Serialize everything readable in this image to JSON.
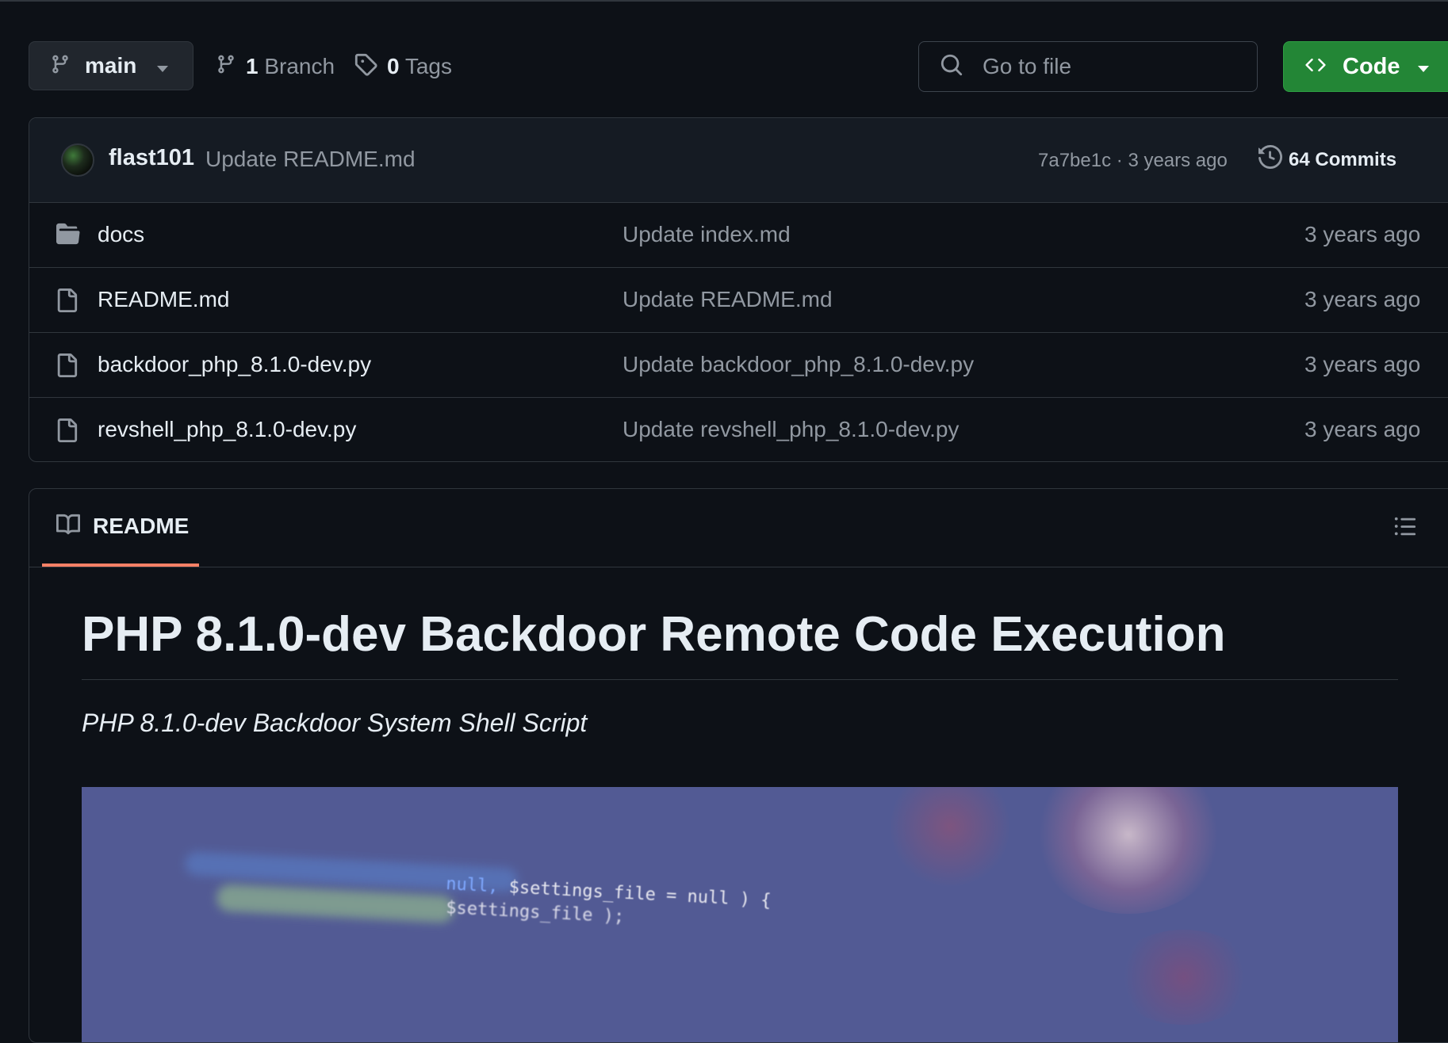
{
  "toolbar": {
    "branch_label": "main",
    "branch_count": "1",
    "branch_word": "Branch",
    "tag_count": "0",
    "tag_word": "Tags",
    "search_placeholder": "Go to file",
    "code_label": "Code"
  },
  "last_commit": {
    "author": "flast101",
    "message": "Update README.md",
    "sha": "7a7be1c",
    "separator": "·",
    "time": "3 years ago",
    "commits_count": "64 Commits"
  },
  "files": [
    {
      "name": "docs",
      "type": "folder",
      "message": "Update index.md",
      "time": "3 years ago"
    },
    {
      "name": "README.md",
      "type": "file",
      "message": "Update README.md",
      "time": "3 years ago"
    },
    {
      "name": "backdoor_php_8.1.0-dev.py",
      "type": "file",
      "message": "Update backdoor_php_8.1.0-dev.py",
      "time": "3 years ago"
    },
    {
      "name": "revshell_php_8.1.0-dev.py",
      "type": "file",
      "message": "Update revshell_php_8.1.0-dev.py",
      "time": "3 years ago"
    }
  ],
  "readme": {
    "tab_label": "README",
    "heading": "PHP 8.1.0-dev Backdoor Remote Code Execution",
    "subtitle": "PHP 8.1.0-dev Backdoor System Shell Script",
    "image_code_line1_a": "null,",
    "image_code_line1_b": " $settings_file = null ) {",
    "image_code_line2": "$settings_file );"
  },
  "colors": {
    "background": "#0d1117",
    "code_button": "#238636",
    "readme_underline": "#f78166"
  },
  "icons": {
    "branch": "git-branch-icon",
    "tag": "tag-icon",
    "search": "search-icon",
    "code": "code-icon",
    "history": "history-icon",
    "folder": "folder-icon",
    "file": "file-icon",
    "book": "book-icon",
    "list": "list-unordered-icon"
  }
}
